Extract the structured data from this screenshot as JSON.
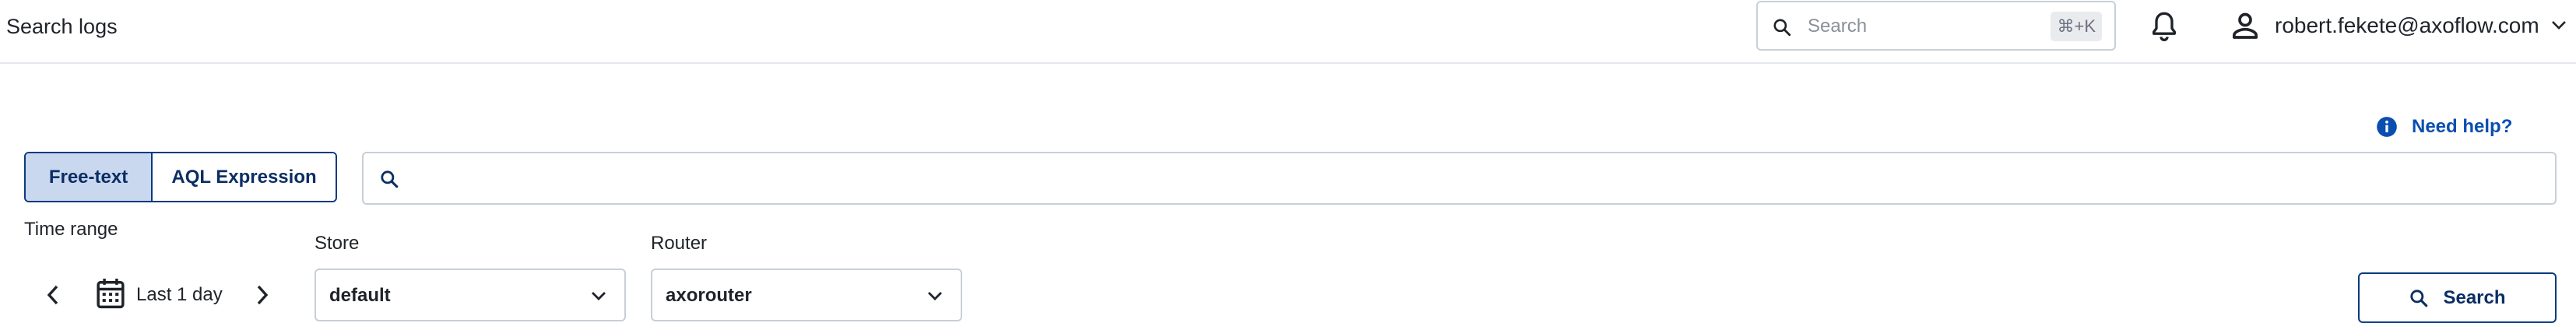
{
  "header": {
    "title": "Search logs",
    "search": {
      "placeholder": "Search",
      "shortcut": "⌘+K"
    },
    "notifications_icon": "bell-icon",
    "user": {
      "icon": "person-icon",
      "email": "robert.fekete@axoflow.com"
    }
  },
  "help": {
    "icon": "info-icon",
    "label": "Need help?"
  },
  "query": {
    "modes": [
      "Free-text",
      "AQL Expression"
    ],
    "active_mode": "Free-text",
    "value": "",
    "placeholder": ""
  },
  "filters": {
    "time_range": {
      "label": "Time range",
      "value": "Last 1 day"
    },
    "store": {
      "label": "Store",
      "value": "default"
    },
    "router": {
      "label": "Router",
      "value": "axorouter"
    }
  },
  "actions": {
    "search_label": "Search"
  },
  "colors": {
    "accent": "#0b3a7e",
    "active_toggle_bg": "#c9d8ef",
    "link": "#0a4fb0",
    "border": "#c9cfd6"
  }
}
